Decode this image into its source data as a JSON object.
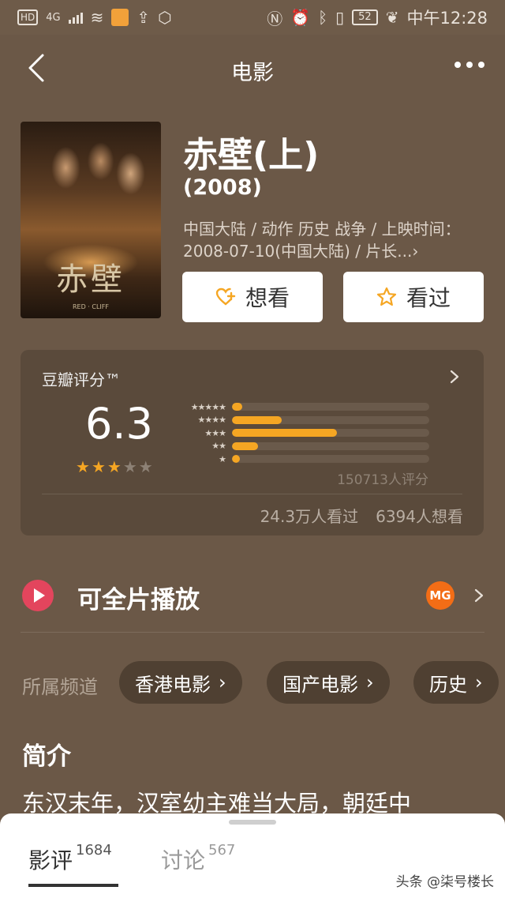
{
  "status_bar": {
    "hd": "HD",
    "network": "4G",
    "battery": "52",
    "time": "中午12:28"
  },
  "nav": {
    "title": "电影"
  },
  "movie": {
    "title": "赤壁(上)",
    "year": "(2008)",
    "meta": "中国大陆 / 动作 历史 战争 / 上映时间：2008-07-10(中国大陆) / 片长...",
    "poster_title": "赤壁",
    "poster_subtitle": "RED · CLIFF"
  },
  "actions": {
    "want_label": "想看",
    "seen_label": "看过"
  },
  "rating": {
    "title": "豆瓣评分™",
    "score": "6.3",
    "stars_filled": 3,
    "stars_total": 5,
    "distribution": [
      {
        "stars": "★★★★★",
        "fraction": 0.05
      },
      {
        "stars": "★★★★",
        "fraction": 0.25
      },
      {
        "stars": "★★★",
        "fraction": 0.53
      },
      {
        "stars": "★★",
        "fraction": 0.13
      },
      {
        "stars": "★",
        "fraction": 0.03
      }
    ],
    "count_text": "150713人评分",
    "seen_text": "24.3万人看过",
    "want_text": "6394人想看"
  },
  "play": {
    "label": "可全片播放",
    "provider_icon": "MG"
  },
  "channels": {
    "label": "所属频道",
    "items": [
      "香港电影",
      "国产电影",
      "历史"
    ]
  },
  "synopsis": {
    "title": "简介",
    "text": "东汉末年，汉室幼主难当大局，朝廷中"
  },
  "sheet": {
    "tabs": [
      {
        "label": "影评",
        "count": "1684"
      },
      {
        "label": "讨论",
        "count": "567"
      }
    ]
  },
  "watermark": "头条 @柒号楼长",
  "colors": {
    "accent": "#f5a623",
    "background": "#6b5847",
    "play": "#e3455d",
    "provider": "#f36d16"
  }
}
